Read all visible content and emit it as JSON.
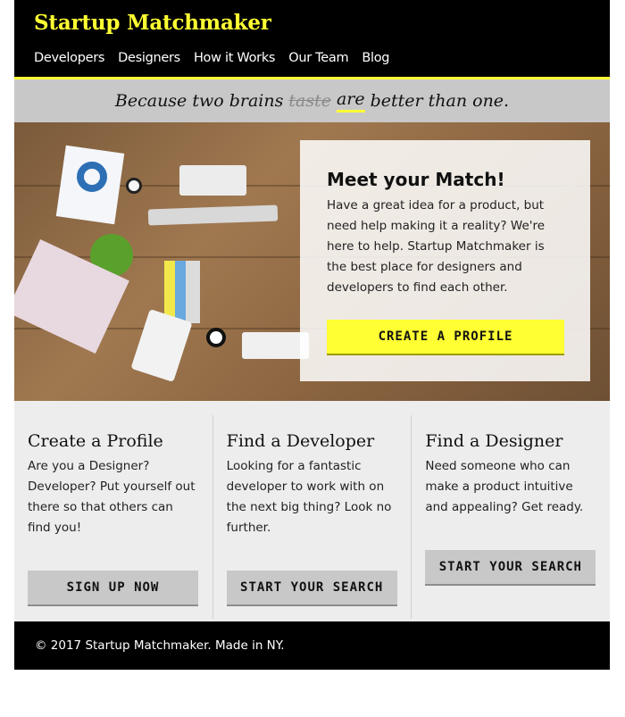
{
  "header": {
    "brand": "Startup Matchmaker",
    "nav": [
      "Developers",
      "Designers",
      "How it Works",
      "Our Team",
      "Blog"
    ]
  },
  "tagline": {
    "before": "Because two brains",
    "struck": "taste",
    "underlined": "are",
    "after": "better than one."
  },
  "hero": {
    "title": "Meet your Match!",
    "body": "Have a great idea for a product, but need help making it a reality? We're here to help. Startup Matchmaker is the best place for designers and developers to find each other.",
    "cta": "CREATE A PROFILE"
  },
  "columns": [
    {
      "title": "Create a Profile",
      "body": "Are you a Designer? Developer? Put yourself out there so that others can find you!",
      "button": "SIGN UP NOW"
    },
    {
      "title": "Find a Developer",
      "body": "Looking for a fantastic developer to work with on the next big thing? Look no further.",
      "button": "START YOUR SEARCH"
    },
    {
      "title": "Find a Designer",
      "body": "Need someone who can make a product intuitive and appealing? Get ready.",
      "button": "START YOUR SEARCH"
    }
  ],
  "footer": {
    "text": "© 2017 Startup Matchmaker. Made in NY."
  },
  "colors": {
    "accent": "#ffff33",
    "header_bg": "#000000",
    "tagline_bg": "#c8c8c8",
    "page_bg": "#ededed"
  }
}
